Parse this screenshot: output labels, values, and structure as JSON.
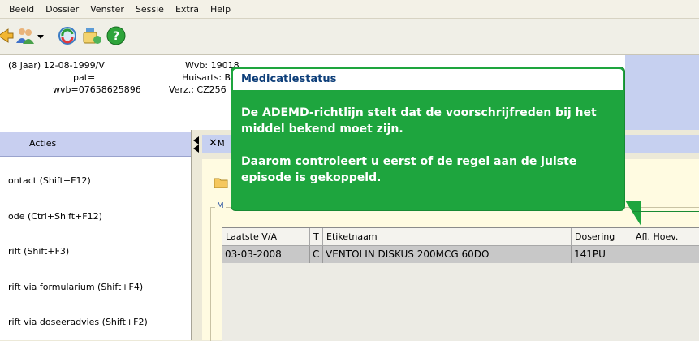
{
  "menubar": {
    "items": [
      "Beeld",
      "Dossier",
      "Venster",
      "Sessie",
      "Extra",
      "Help"
    ]
  },
  "toolbar": {
    "icons": [
      "arrow-icon",
      "people-icon",
      "dropdown-arrow-icon",
      "refresh-icon",
      "medication-icon",
      "help-icon"
    ]
  },
  "patient": {
    "age_dob": "(8 jaar) 12-08-1999/V",
    "pat": "pat=",
    "wvb": "wvb=07658625896",
    "wvb_right": "Wvb: 19018",
    "huisarts": "Huisarts: Brir",
    "verz": "Verz.: CZ256"
  },
  "acties": {
    "title": "Acties",
    "items": [
      "ontact  (Shift+F12)",
      "ode  (Ctrl+Shift+F12)",
      "rift  (Shift+F3)",
      "rift via formularium  (Shift+F4)",
      "rift via doseeradvies  (Shift+F2)"
    ]
  },
  "tab": {
    "label": "M"
  },
  "group": {
    "label": "M"
  },
  "grid": {
    "columns": [
      "Laatste V/A",
      "T",
      "Etiketnaam",
      "Dosering",
      "Afl. Hoev."
    ],
    "rows": [
      [
        "03-03-2008",
        "C",
        "VENTOLIN DISKUS 200MCG 60DO",
        "141PU",
        ""
      ]
    ]
  },
  "callout": {
    "title": "Medicatiestatus",
    "paragraph1": "De ADEMD-richtlijn stelt dat de voorschrijfreden bij het middel bekend moet zijn.",
    "paragraph2": "Daarom controleert u eerst of de regel aan de juiste episode is gekoppeld."
  },
  "colors": {
    "callout_green": "#1ea53e",
    "header_blue": "#c6d0f0",
    "panel_yellow": "#fffbe1",
    "title_blue": "#0e3f7a"
  }
}
